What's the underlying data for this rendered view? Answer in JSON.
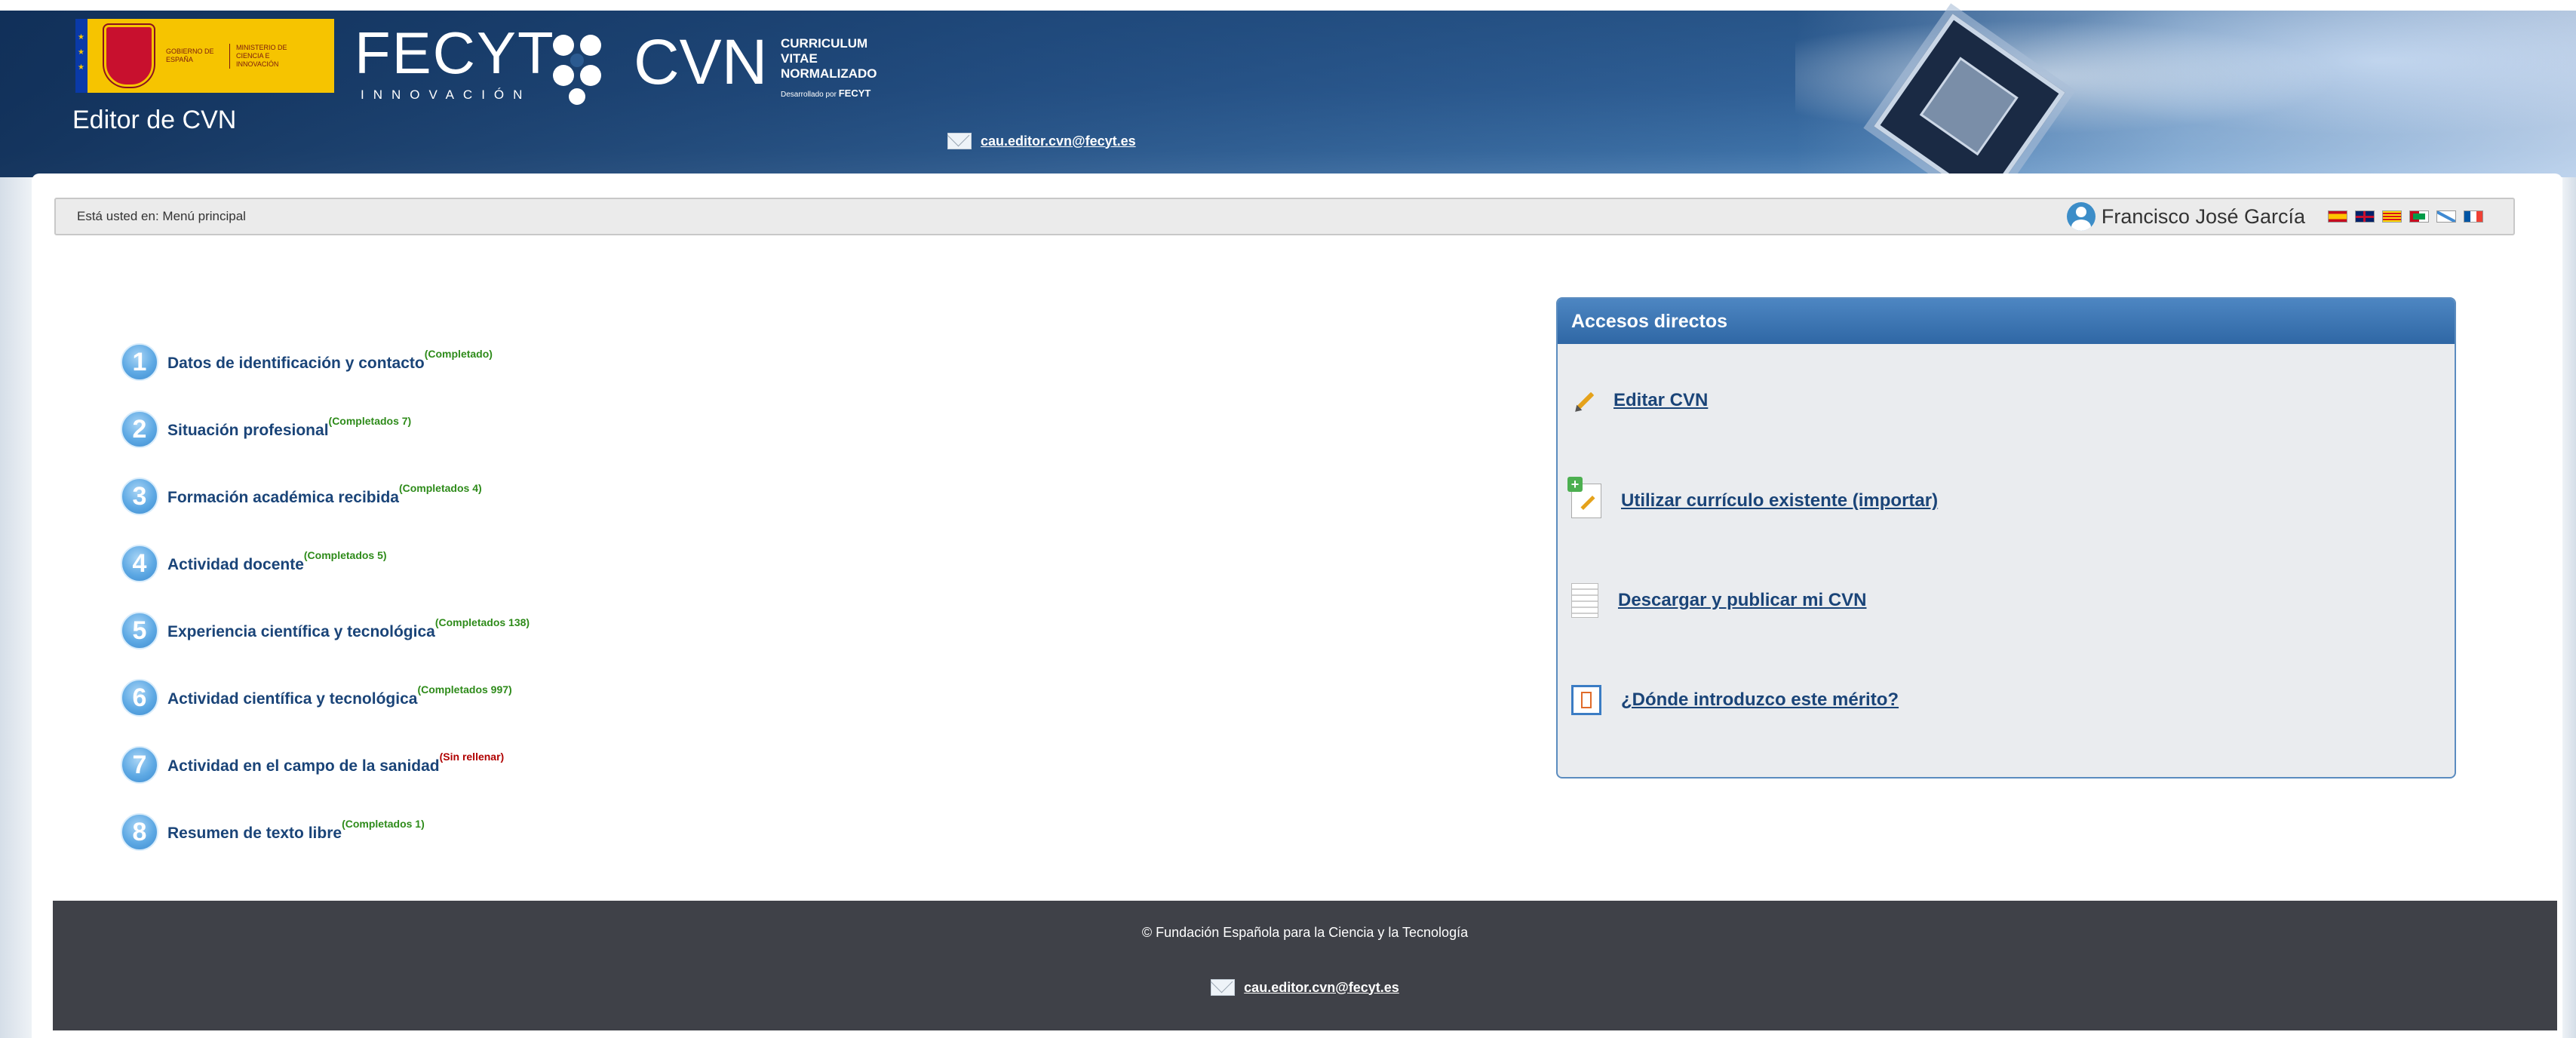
{
  "header": {
    "gov_logo_lines_1": "GOBIERNO DE ESPAÑA",
    "gov_logo_lines_2": "MINISTERIO DE CIENCIA E INNOVACIÓN",
    "fecyt_word": "FECYT",
    "fecyt_sub": "INNOVACIÓN",
    "cvn_word": "CVN",
    "cvn_sub_1": "CURRICULUM",
    "cvn_sub_2": "VITAE",
    "cvn_sub_3": "NORMALIZADO",
    "cvn_dev_prefix": "Desarrollado por",
    "cvn_dev_brand": "FECYT",
    "editor_title": "Editor de CVN",
    "email": "cau.editor.cvn@fecyt.es"
  },
  "breadcrumb": {
    "text": "Está usted en: Menú principal"
  },
  "user": {
    "name": "Francisco José García"
  },
  "languages": [
    "es",
    "en",
    "ca",
    "eu",
    "gl",
    "fr"
  ],
  "menu": [
    {
      "number": "1",
      "label": "Datos de identificación y contacto",
      "status": "(Completado)",
      "state": "complete"
    },
    {
      "number": "2",
      "label": "Situación profesional",
      "status": "(Completados 7)",
      "state": "complete"
    },
    {
      "number": "3",
      "label": "Formación académica recibida",
      "status": "(Completados 4)",
      "state": "complete"
    },
    {
      "number": "4",
      "label": "Actividad docente",
      "status": "(Completados 5)",
      "state": "complete"
    },
    {
      "number": "5",
      "label": "Experiencia científica y tecnológica",
      "status": "(Completados 138)",
      "state": "complete"
    },
    {
      "number": "6",
      "label": "Actividad científica y tecnológica",
      "status": "(Completados 997)",
      "state": "complete"
    },
    {
      "number": "7",
      "label": "Actividad en el campo de la sanidad",
      "status": "(Sin rellenar)",
      "state": "empty"
    },
    {
      "number": "8",
      "label": "Resumen de texto libre",
      "status": "(Completados 1)",
      "state": "complete"
    }
  ],
  "accesos": {
    "title": "Accesos directos",
    "items": [
      {
        "label": "Editar CVN",
        "icon": "pencil-icon"
      },
      {
        "label": "Utilizar currículo existente (importar)",
        "icon": "import-icon"
      },
      {
        "label": "Descargar y publicar mi CVN",
        "icon": "document-icon"
      },
      {
        "label": "¿Dónde introduzco este mérito?",
        "icon": "help-location-icon"
      }
    ]
  },
  "footer": {
    "copyright": "© Fundación Española para la Ciencia y la Tecnología",
    "email": "cau.editor.cvn@fecyt.es"
  },
  "colors": {
    "header_blue": "#1f4a7c",
    "link_blue": "#1a4478",
    "status_green": "#2e8b1a",
    "status_red": "#b00000",
    "footer_bg": "#3f4148"
  }
}
